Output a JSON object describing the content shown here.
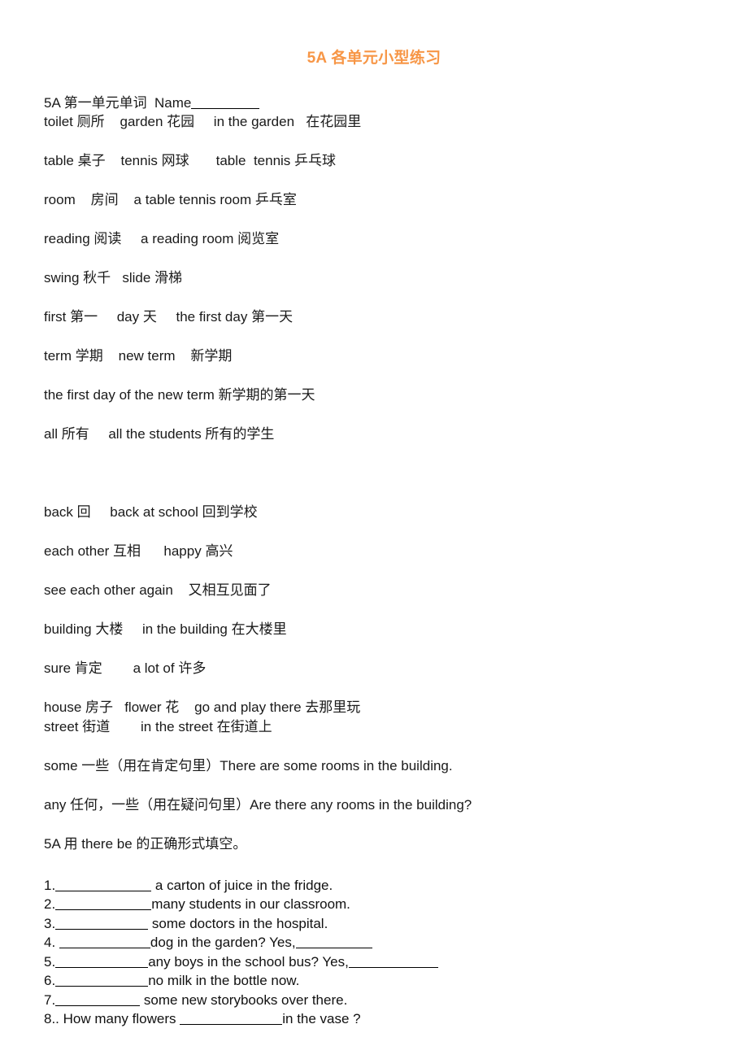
{
  "document": {
    "title": "5A 各单元小型练习",
    "title_color": "#F79646",
    "page_background": "#ffffff",
    "text_color": "#111111"
  },
  "header_line": {
    "prefix": "5A 第一单元单词  Name",
    "blank_label": "________"
  },
  "vocabulary_lines": [
    {
      "text": "toilet 厕所    garden 花园     in the garden   在花园里",
      "spacing": "normal"
    },
    {
      "text": "table 桌子    tennis 网球       table  tennis 乒乓球",
      "spacing": "normal"
    },
    {
      "text": "room    房间    a table tennis room 乒乓室",
      "spacing": "normal"
    },
    {
      "text": "reading 阅读     a reading room 阅览室",
      "spacing": "normal"
    },
    {
      "text": "swing 秋千   slide 滑梯",
      "spacing": "normal"
    },
    {
      "text": "first 第一     day 天     the first day 第一天",
      "spacing": "normal"
    },
    {
      "text": "term 学期    new term    新学期",
      "spacing": "normal"
    },
    {
      "text": "the first day of the new term 新学期的第一天",
      "spacing": "normal"
    },
    {
      "text": "all 所有     all the students 所有的学生",
      "spacing": "wide"
    },
    {
      "text": "back 回     back at school 回到学校",
      "spacing": "normal"
    },
    {
      "text": "each other 互相      happy 高兴",
      "spacing": "normal"
    },
    {
      "text": "see each other again    又相互见面了",
      "spacing": "normal"
    },
    {
      "text": "building 大楼     in the building 在大楼里",
      "spacing": "normal"
    },
    {
      "text": "sure 肯定        a lot of 许多",
      "spacing": "normal"
    },
    {
      "text": "house 房子   flower 花    go and play there 去那里玩",
      "spacing": "tight"
    },
    {
      "text": "street 街道        in the street 在街道上",
      "spacing": "normal"
    },
    {
      "text": "some 一些（用在肯定句里）There are some rooms in the building.",
      "spacing": "normal"
    },
    {
      "text": "any 任何，一些（用在疑问句里）Are there any rooms in the building?",
      "spacing": "normal"
    }
  ],
  "exercise": {
    "instruction": "5A 用 there be 的正确形式填空。",
    "items": [
      {
        "number": "1.",
        "blank1_width": 118,
        "after1": " a carton of juice in the fridge.",
        "blank2_width": 0,
        "after2": ""
      },
      {
        "number": "2.",
        "blank1_width": 118,
        "after1": "many students in our classroom.",
        "blank2_width": 0,
        "after2": ""
      },
      {
        "number": "3.",
        "blank1_width": 114,
        "after1": " some doctors in the hospital.",
        "blank2_width": 0,
        "after2": ""
      },
      {
        "number": "4. ",
        "blank1_width": 112,
        "after1": "dog in the garden? Yes,",
        "blank2_width": 94,
        "after2": ""
      },
      {
        "number": "5.",
        "blank1_width": 114,
        "after1": "any boys in the school bus? Yes,",
        "blank2_width": 110,
        "after2": ""
      },
      {
        "number": "6.",
        "blank1_width": 114,
        "after1": "no milk in the bottle now.",
        "blank2_width": 0,
        "after2": ""
      },
      {
        "number": "7.",
        "blank1_width": 104,
        "after1": " some new storybooks over there.",
        "blank2_width": 0,
        "after2": ""
      },
      {
        "number": "8.. How many flowers ",
        "blank1_width": 126,
        "after1": "in the vase ?",
        "blank2_width": 0,
        "after2": ""
      }
    ]
  }
}
